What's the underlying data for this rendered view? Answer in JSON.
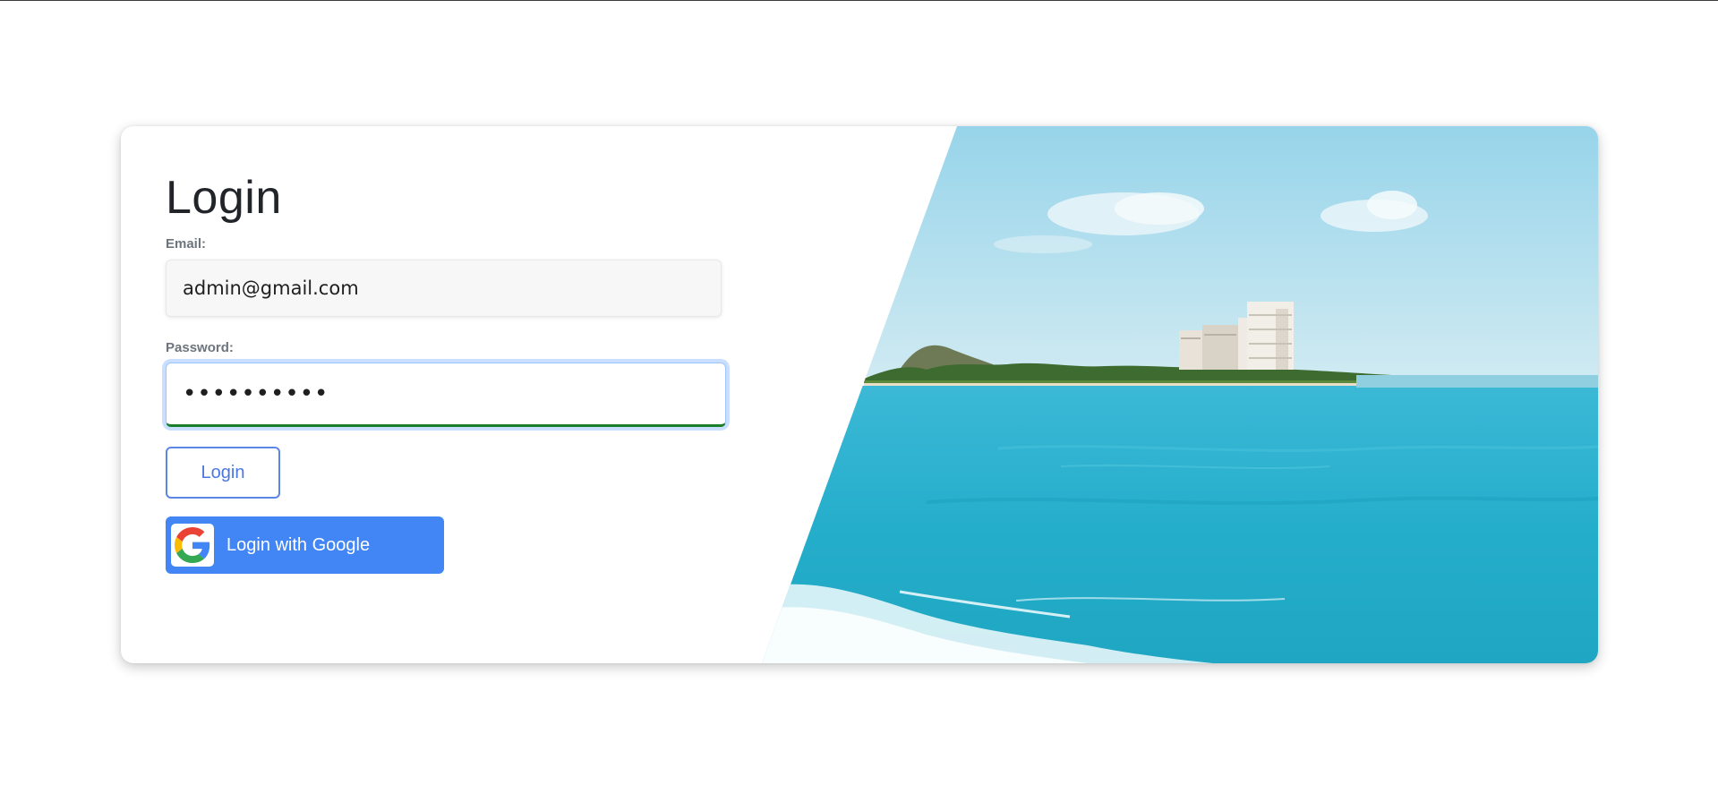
{
  "login": {
    "title": "Login",
    "email_label": "Email:",
    "email_value": "admin@gmail.com",
    "password_label": "Password:",
    "password_value": "••••••••••",
    "login_button": "Login",
    "google_button": "Login with Google"
  },
  "colors": {
    "primary": "#4a78e0",
    "google_blue": "#4285f4",
    "focus_underline": "#1a7f2a",
    "sky": "#9fd6ea",
    "sea": "#2cb3cf"
  },
  "icons": {
    "google": "google-g-logo"
  }
}
